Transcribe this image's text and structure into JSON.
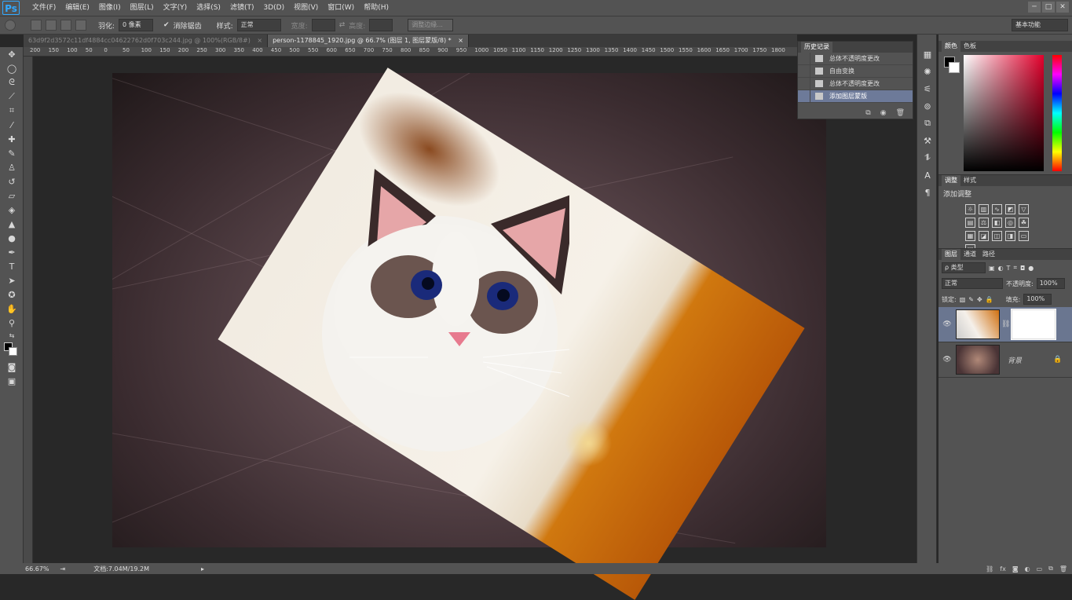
{
  "app": {
    "logo": "Ps"
  },
  "menu": [
    "文件(F)",
    "编辑(E)",
    "图像(I)",
    "图层(L)",
    "文字(Y)",
    "选择(S)",
    "滤镜(T)",
    "3D(D)",
    "视图(V)",
    "窗口(W)",
    "帮助(H)"
  ],
  "window_controls": [
    "─",
    "□",
    "✕"
  ],
  "options": {
    "feather_label": "羽化:",
    "feather_value": "0 像素",
    "antialias_label": "消除锯齿",
    "style_label": "样式:",
    "style_value": "正常",
    "width_label": "宽度:",
    "height_label": "高度:",
    "refine_button": "调整边缘...",
    "workspace": "基本功能"
  },
  "tabs": [
    {
      "label": "63d9f2d3572c11df4884cc04622762d0f703c244.jpg @ 100%(RGB/8#)",
      "close": "×"
    },
    {
      "label": "person-1178845_1920.jpg @ 66.7% (图层 1, 图层蒙版/8) *",
      "close": "×"
    }
  ],
  "ruler_ticks": [
    "200",
    "150",
    "100",
    "50",
    "0",
    "50",
    "100",
    "150",
    "200",
    "250",
    "300",
    "350",
    "400",
    "450",
    "500",
    "550",
    "600",
    "650",
    "700",
    "750",
    "800",
    "850",
    "900",
    "950",
    "1000",
    "1050",
    "1100",
    "1150",
    "1200",
    "1250",
    "1300",
    "1350",
    "1400",
    "1450",
    "1500",
    "1550",
    "1600",
    "1650",
    "1700",
    "1750",
    "1800"
  ],
  "status": {
    "zoom": "66.67%",
    "doc": "文档:7.04M/19.2M"
  },
  "history": {
    "tabs": [
      "历史记录"
    ],
    "items": [
      "总体不透明度更改",
      "自由变换",
      "总体不透明度更改",
      "添加图层蒙版"
    ],
    "selected_index": 3
  },
  "color_panel": {
    "tabs": [
      "颜色",
      "色板"
    ],
    "foreground": "#000000",
    "background": "#ffffff",
    "hue": "#e3002c"
  },
  "adjustments": {
    "tabs": [
      "调整",
      "样式"
    ],
    "title": "添加调整"
  },
  "layers": {
    "tabs": [
      "图层",
      "通道",
      "路径"
    ],
    "filter": "ρ 类型",
    "blend_mode": "正常",
    "opacity_label": "不透明度:",
    "opacity_value": "100%",
    "lock_label": "锁定:",
    "fill_label": "填充:",
    "fill_value": "100%",
    "items": [
      {
        "name": "",
        "has_mask": true,
        "selected": true
      },
      {
        "name": "背景",
        "locked": true
      }
    ]
  }
}
